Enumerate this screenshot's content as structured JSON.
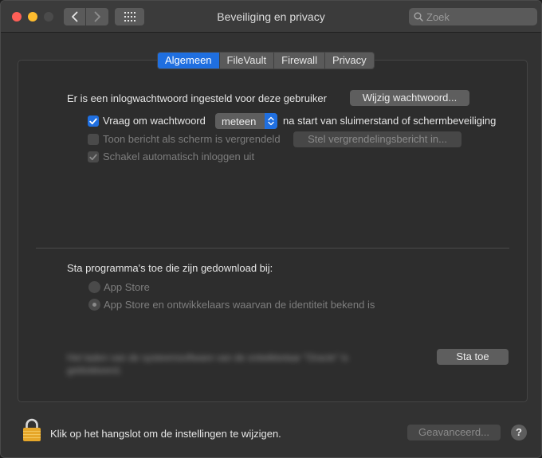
{
  "window": {
    "title": "Beveiliging en privacy"
  },
  "search": {
    "placeholder": "Zoek"
  },
  "tabs": [
    {
      "label": "Algemeen",
      "active": true
    },
    {
      "label": "FileVault",
      "active": false
    },
    {
      "label": "Firewall",
      "active": false
    },
    {
      "label": "Privacy",
      "active": false
    }
  ],
  "login": {
    "text": "Er is een inlogwachtwoord ingesteld voor deze gebruiker",
    "change_button": "Wijzig wachtwoord..."
  },
  "require_password": {
    "label": "Vraag om wachtwoord",
    "checked": true,
    "popup_value": "meteen",
    "suffix": "na start van sluimerstand of schermbeveiliging"
  },
  "show_message": {
    "label": "Toon bericht als scherm is vergrendeld",
    "checked": false,
    "enabled": false,
    "button": "Stel vergrendelingsbericht in..."
  },
  "disable_autologin": {
    "label": "Schakel automatisch inloggen uit",
    "checked": true,
    "enabled": false
  },
  "downloads": {
    "heading": "Sta programma's toe die zijn gedownload bij:",
    "options": [
      {
        "label": "App Store",
        "selected": false
      },
      {
        "label": "App Store en ontwikkelaars waarvan de identiteit bekend is",
        "selected": true
      }
    ]
  },
  "blocked": {
    "text": "Het laden van de systeemsoftware van de ontwikkelaar \"Oracle\" is geblokkeerd.",
    "allow_button": "Sta toe"
  },
  "footer": {
    "lock_text": "Klik op het hangslot om de instellingen te wijzigen.",
    "advanced_button": "Geavanceerd...",
    "help_label": "?"
  },
  "colors": {
    "accent": "#1f6fe0",
    "close": "#fe5f57",
    "minimize": "#febc2e",
    "lock": "#e6a72a"
  },
  "icons": [
    "back-icon",
    "forward-icon",
    "grid-icon",
    "search-icon",
    "chevron-updown-icon",
    "checkmark-icon",
    "lock-icon"
  ]
}
